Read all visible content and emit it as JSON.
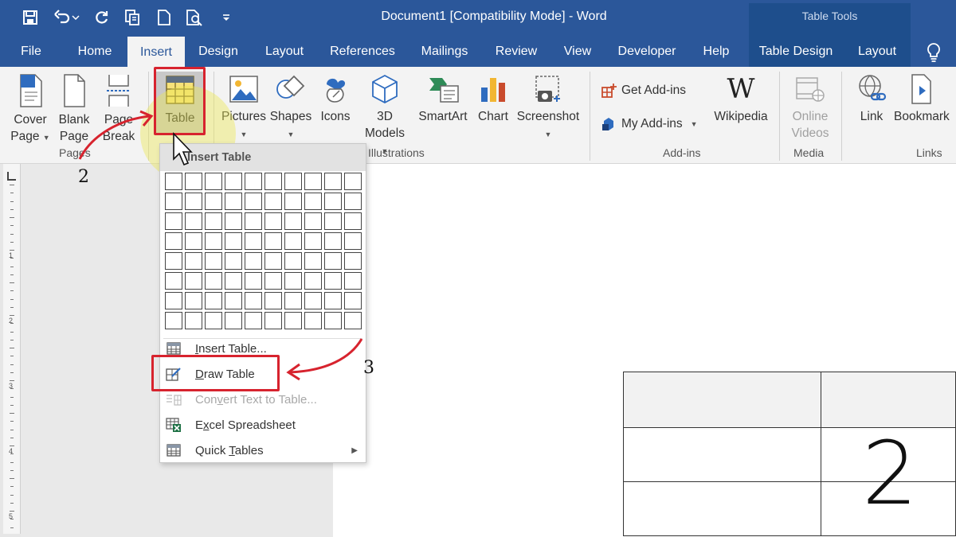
{
  "window": {
    "title": "Document1 [Compatibility Mode]  -  Word",
    "context_group": "Table Tools"
  },
  "quick_access": [
    "save-icon",
    "undo-icon",
    "redo-icon",
    "print-preview-icon",
    "new-document-icon",
    "print-icon",
    "customize-qat-icon"
  ],
  "tabs": [
    {
      "label": "File"
    },
    {
      "label": "Home"
    },
    {
      "label": "Insert",
      "active": true
    },
    {
      "label": "Design"
    },
    {
      "label": "Layout"
    },
    {
      "label": "References"
    },
    {
      "label": "Mailings"
    },
    {
      "label": "Review"
    },
    {
      "label": "View"
    },
    {
      "label": "Developer"
    },
    {
      "label": "Help"
    },
    {
      "label": "Table Design"
    },
    {
      "label": "Layout"
    }
  ],
  "ribbon": {
    "pages": {
      "cover_l1": "Cover",
      "cover_l2": "Page",
      "blank_l1": "Blank",
      "blank_l2": "Page",
      "break_l1": "Page",
      "break_l2": "Break",
      "group": "Pages"
    },
    "tables": {
      "table": "Table"
    },
    "illustrations": {
      "pictures": "Pictures",
      "shapes": "Shapes",
      "icons": "Icons",
      "models_l1": "3D",
      "models_l2": "Models",
      "smartart": "SmartArt",
      "chart": "Chart",
      "screenshot": "Screenshot",
      "group": "Illustrations"
    },
    "addins": {
      "get": "Get Add-ins",
      "my": "My Add-ins",
      "wikipedia": "Wikipedia",
      "group": "Add-ins"
    },
    "media": {
      "online_l1": "Online",
      "online_l2": "Videos",
      "group": "Media"
    },
    "links": {
      "link": "Link",
      "bookmark": "Bookmark",
      "group": "Links"
    }
  },
  "menu": {
    "header": "Insert Table",
    "grid": {
      "cols": 10,
      "rows": 8
    },
    "items": [
      {
        "pre": "",
        "key": "I",
        "post": "nsert Table...",
        "enabled": true
      },
      {
        "pre": "",
        "key": "D",
        "post": "raw Table",
        "enabled": true
      },
      {
        "pre": "Con",
        "key": "v",
        "post": "ert Text to Table...",
        "enabled": false
      },
      {
        "pre": "E",
        "key": "x",
        "post": "cel Spreadsheet",
        "enabled": true
      },
      {
        "pre": "Quick ",
        "key": "T",
        "post": "ables",
        "enabled": true
      }
    ]
  },
  "annotations": {
    "step_table": "2",
    "step_draw": "3",
    "corner": "2"
  },
  "ruler": {
    "numbers": [
      "1",
      "2",
      "3",
      "4",
      "5"
    ]
  },
  "colors": {
    "accent": "#2b579a",
    "annotation_red": "#d7232e",
    "highlight": "#ebe650"
  }
}
